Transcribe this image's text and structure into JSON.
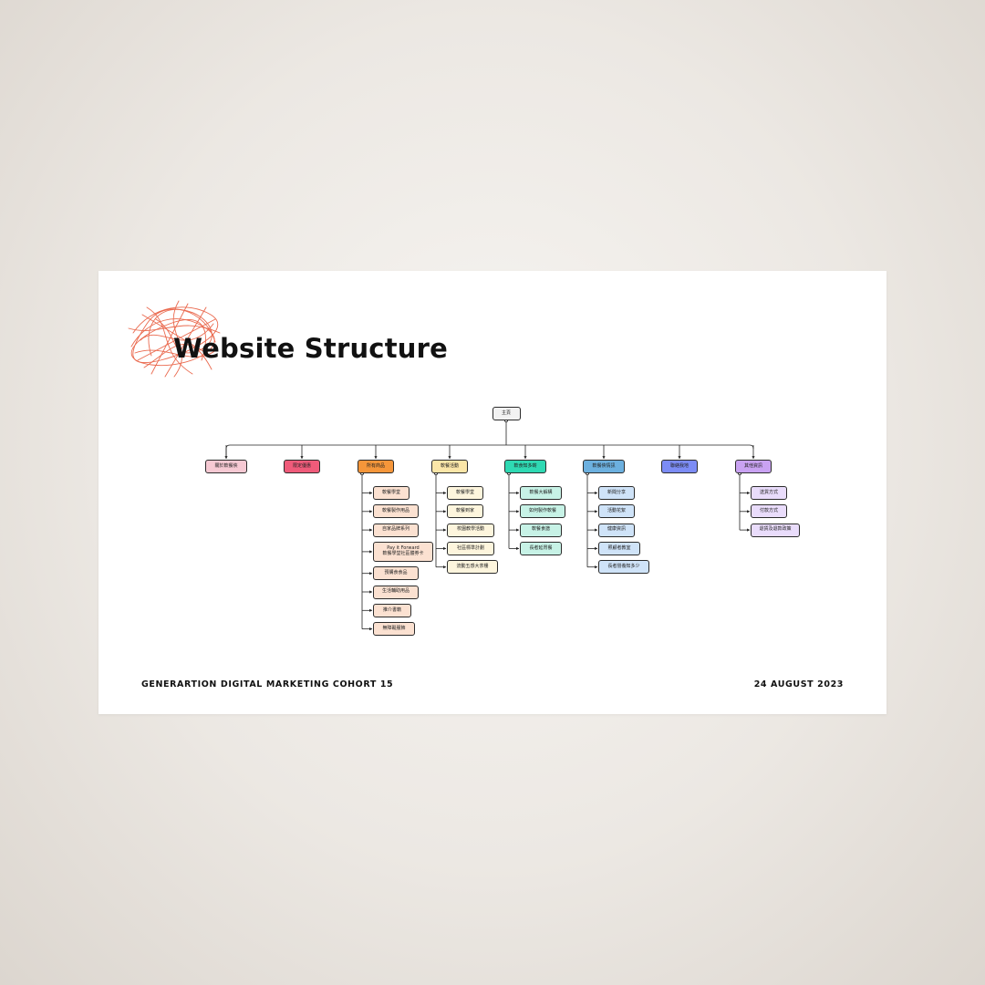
{
  "slide": {
    "title": "Website Structure",
    "footer_left": "GENERARTION DIGITAL MARKETING COHORT 15",
    "footer_right": "24 AUGUST 2023"
  },
  "tree": {
    "root": "主頁",
    "categories": [
      {
        "label": "關於軟餐俠",
        "color": "#f6c9d3",
        "children": []
      },
      {
        "label": "限定優惠",
        "color": "#ef5b7a",
        "children": []
      },
      {
        "label": "所有商品",
        "color": "#f5963a",
        "child_color": "#fbe1d1",
        "children": [
          "軟餐學堂",
          "軟餐製作用品",
          "自家品牌系列",
          "Pay it Forward\n軟餐學堂社區體券卡",
          "預購食食品",
          "生活輔助用品",
          "推介書籍",
          "無障礙服飾"
        ]
      },
      {
        "label": "軟餐活動",
        "color": "#fbe6a8",
        "child_color": "#fdf5dd",
        "children": [
          "軟餐學堂",
          "軟餐到家",
          "校園教學活動",
          "社區標準計劃",
          "流動五感大茶樓"
        ]
      },
      {
        "label": "軟食知多啲",
        "color": "#2fd9b3",
        "child_color": "#c7f2e6",
        "children": [
          "軟餐大解構",
          "如何製作軟餐",
          "軟餐食譜",
          "長者延胃餐"
        ]
      },
      {
        "label": "軟餐俠情訊",
        "color": "#6cb0df",
        "child_color": "#cfe3f8",
        "children": [
          "新聞分享",
          "活動花絮",
          "健康資訊",
          "照顧者教室",
          "長者營養知多少"
        ]
      },
      {
        "label": "聯絡我地",
        "color": "#7c8cf5",
        "children": []
      },
      {
        "label": "其他資訊",
        "color": "#c9a2f2",
        "child_color": "#e9dcfb",
        "children": [
          "送貨方式",
          "付款方式",
          "退貨及退款政策"
        ]
      }
    ]
  }
}
